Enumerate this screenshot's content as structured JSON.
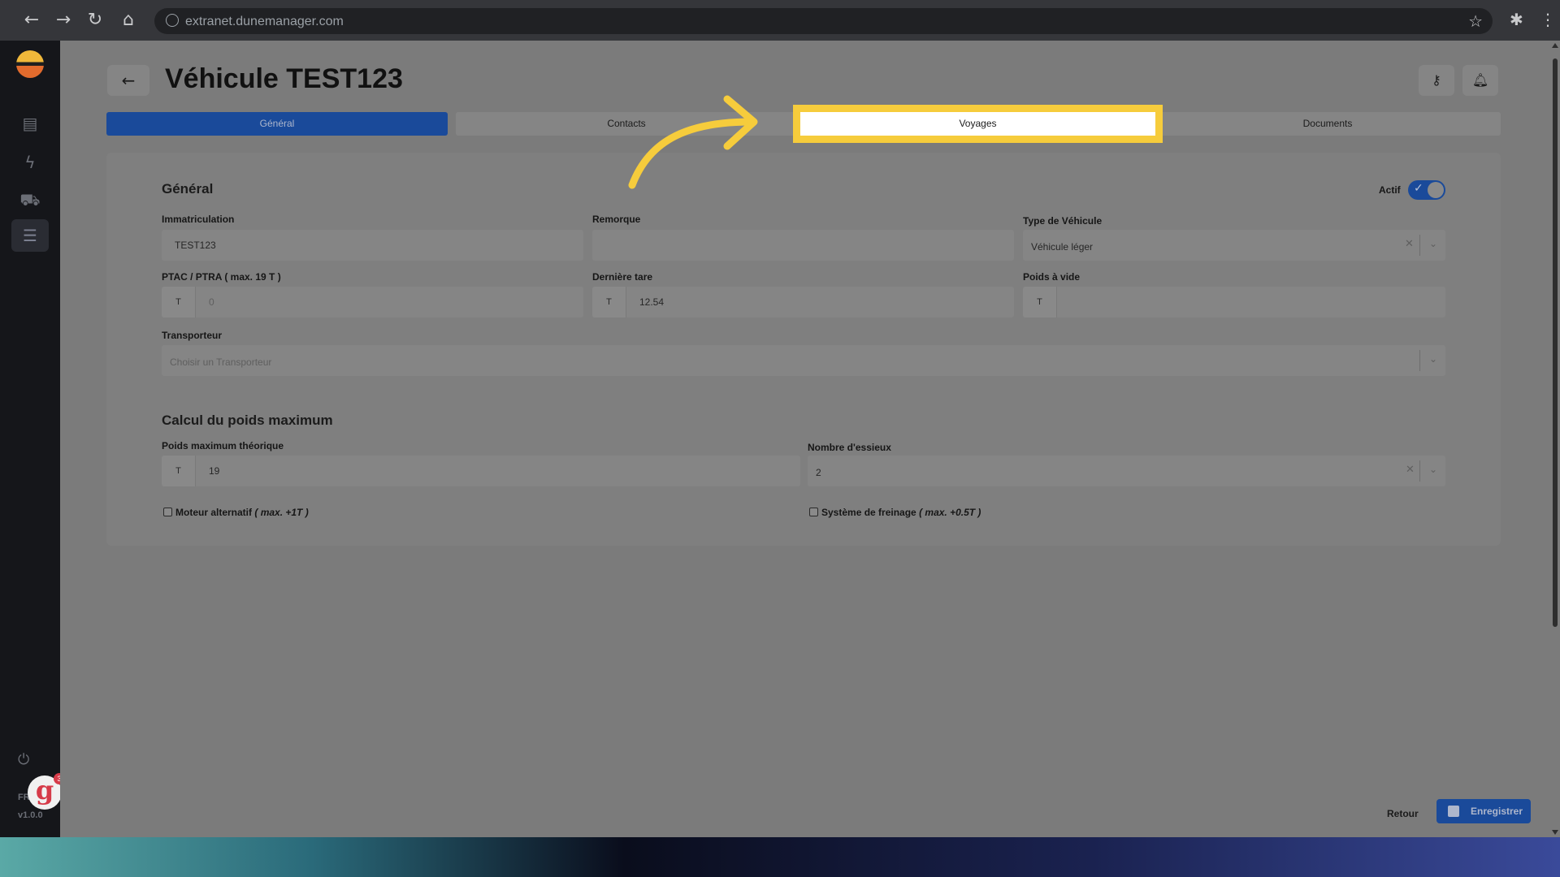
{
  "browser": {
    "url": "extranet.dunemanager.com"
  },
  "sidebar": {
    "lang": "FR",
    "version": "v1.0.0",
    "notification_count": "3",
    "badge_letter": "g"
  },
  "page": {
    "title": "Véhicule TEST123"
  },
  "tabs": [
    {
      "label": "Général"
    },
    {
      "label": "Contacts"
    },
    {
      "label": "Voyages"
    },
    {
      "label": "Documents"
    }
  ],
  "general": {
    "section_title": "Général",
    "actif_label": "Actif",
    "immatriculation": {
      "label": "Immatriculation",
      "value": "TEST123"
    },
    "remorque": {
      "label": "Remorque",
      "value": ""
    },
    "type_vehicule": {
      "label": "Type de Véhicule",
      "value": "Véhicule léger"
    },
    "ptac": {
      "label": "PTAC / PTRA ( max. 19 T )",
      "prefix": "T",
      "value": "0"
    },
    "derniere_tare": {
      "label": "Dernière tare",
      "prefix": "T",
      "value": "12.54"
    },
    "poids_vide": {
      "label": "Poids à vide",
      "prefix": "T",
      "value": ""
    },
    "transporteur": {
      "label": "Transporteur",
      "placeholder": "Choisir un Transporteur"
    }
  },
  "calcul": {
    "section_title": "Calcul du poids maximum",
    "poids_max": {
      "label": "Poids maximum théorique",
      "prefix": "T",
      "value": "19"
    },
    "essieux": {
      "label": "Nombre d'essieux",
      "value": "2"
    },
    "moteur": {
      "label": "Moteur alternatif",
      "hint": "( max. +1T )"
    },
    "freinage": {
      "label": "Système de freinage",
      "hint": "( max. +0.5T )"
    }
  },
  "footer": {
    "retour": "Retour",
    "save": "Enregistrer"
  },
  "colors": {
    "accent": "#1a4a9a",
    "highlight": "#f6cc3c"
  }
}
